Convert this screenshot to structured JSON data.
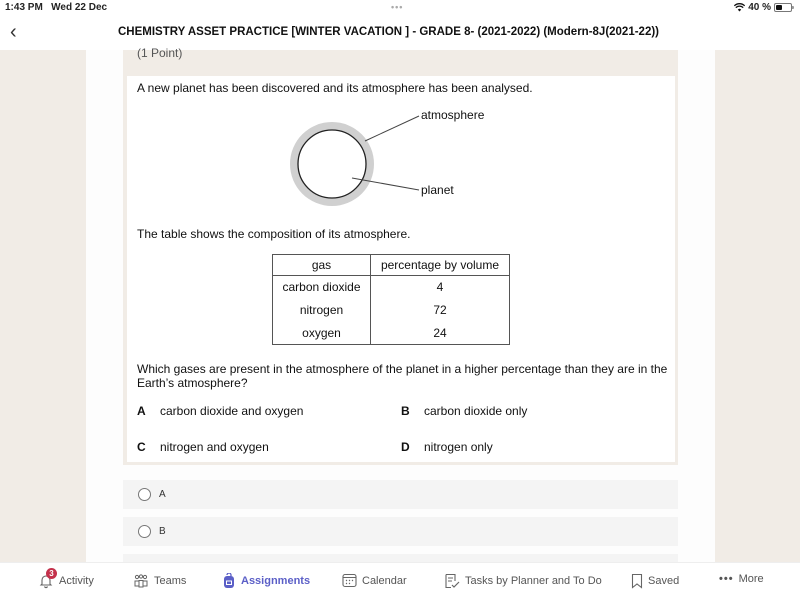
{
  "status_bar": {
    "time": "1:43 PM",
    "date": "Wed 22 Dec",
    "battery": "40 %",
    "battery_level": 0.4
  },
  "header": {
    "title": "CHEMISTRY ASSET PRACTICE [WINTER VACATION ] - GRADE 8-  (2021-2022) (Modern-8J(2021-22))"
  },
  "question": {
    "points": "(1 Point)",
    "intro": "A new planet has been discovered and its atmosphere has been analysed.",
    "diagram": {
      "label_atmosphere": "atmosphere",
      "label_planet": "planet"
    },
    "table_intro": "The table shows the composition of its atmosphere.",
    "table": {
      "headers": [
        "gas",
        "percentage by volume"
      ],
      "rows": [
        [
          "carbon dioxide",
          "4"
        ],
        [
          "nitrogen",
          "72"
        ],
        [
          "oxygen",
          "24"
        ]
      ]
    },
    "text": "Which gases are present in the atmosphere of the planet in a higher percentage than they are in the Earth’s atmosphere?",
    "options": [
      {
        "letter": "A",
        "text": "carbon dioxide and oxygen"
      },
      {
        "letter": "B",
        "text": "carbon dioxide only"
      },
      {
        "letter": "C",
        "text": "nitrogen and oxygen"
      },
      {
        "letter": "D",
        "text": "nitrogen only"
      }
    ]
  },
  "answers": [
    {
      "label": "A",
      "selected": false
    },
    {
      "label": "B",
      "selected": false
    }
  ],
  "tabbar": {
    "active_color": "#5b5fc7",
    "items": [
      {
        "label": "Activity",
        "icon": "bell-icon",
        "badge": "3"
      },
      {
        "label": "Teams",
        "icon": "teams-icon"
      },
      {
        "label": "Assignments",
        "icon": "backpack-icon",
        "active": true
      },
      {
        "label": "Calendar",
        "icon": "calendar-icon"
      },
      {
        "label": "Tasks by Planner and To Do",
        "icon": "tasks-icon"
      },
      {
        "label": "Saved",
        "icon": "bookmark-icon"
      },
      {
        "label": "More",
        "icon": "more-icon"
      }
    ]
  }
}
